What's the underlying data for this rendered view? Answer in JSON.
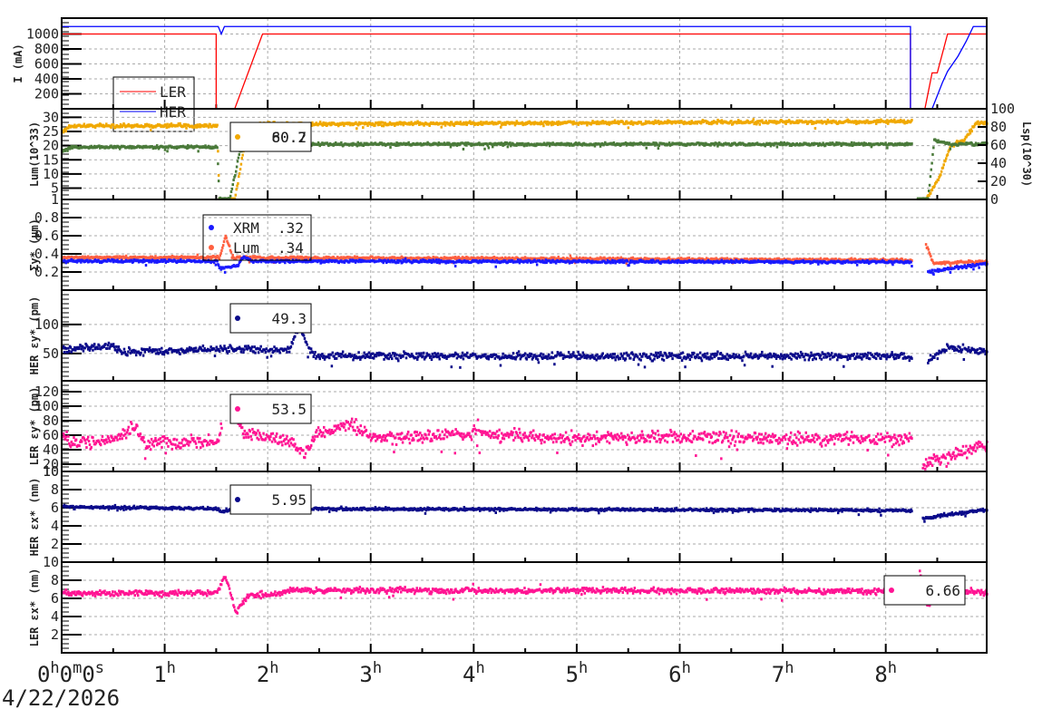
{
  "chart_data": {
    "type": "scatter",
    "x_unit": "hours",
    "xlim": [
      0,
      8.98
    ],
    "x_tick_labels": [
      "0h0m0s",
      "1h",
      "2h",
      "3h",
      "4h",
      "5h",
      "6h",
      "7h",
      "8h"
    ],
    "date_label": "4/22/2026",
    "grid": true,
    "panels": [
      {
        "ylabel": "I (mA)",
        "ylim": [
          0,
          1212
        ],
        "yticks": [
          200,
          400,
          600,
          800,
          1000
        ],
        "legend": {
          "placement": "left",
          "entries": [
            {
              "label": "LER",
              "color": "#ff0000"
            },
            {
              "label": "HER",
              "color": "#0000ff"
            }
          ]
        },
        "series": [
          {
            "name": "LER",
            "kind": "line",
            "color": "#ff0000",
            "segments": [
              [
                [
                  0,
                  1000
                ],
                [
                  1.5,
                  1000
                ],
                [
                  1.5,
                  0
                ],
                [
                  1.68,
                  0
                ],
                [
                  1.95,
                  1000
                ],
                [
                  8.24,
                  1000
                ],
                [
                  8.24,
                  0
                ],
                [
                  8.38,
                  0
                ],
                [
                  8.45,
                  480
                ],
                [
                  8.5,
                  480
                ],
                [
                  8.6,
                  1000
                ],
                [
                  8.98,
                  1000
                ]
              ]
            ]
          },
          {
            "name": "HER",
            "kind": "line",
            "color": "#0000ff",
            "segments": [
              [
                [
                  0,
                  1100
                ],
                [
                  1.52,
                  1100
                ],
                [
                  1.55,
                  1000
                ],
                [
                  1.58,
                  1100
                ],
                [
                  8.24,
                  1100
                ],
                [
                  8.24,
                  0
                ],
                [
                  8.45,
                  0
                ],
                [
                  8.55,
                  350
                ],
                [
                  8.6,
                  500
                ],
                [
                  8.7,
                  700
                ],
                [
                  8.78,
                  900
                ],
                [
                  8.85,
                  1100
                ],
                [
                  8.98,
                  1100
                ]
              ]
            ]
          }
        ]
      },
      {
        "ylabel": "Lum(10^33)",
        "ylim": [
          1,
          33
        ],
        "yticks": [
          1,
          5,
          10,
          15,
          20,
          25,
          30
        ],
        "right_axis": {
          "label": "Lsp(10^30)",
          "ylim": [
            0,
            100
          ],
          "yticks": [
            0,
            20,
            40,
            60,
            80,
            100
          ]
        },
        "legend": {
          "placement": "top-center",
          "values": [
            "80.7",
            "60.2"
          ],
          "color": "#f0a800"
        },
        "series": [
          {
            "name": "Lum",
            "color": "#f0a800",
            "noise": 0.5,
            "segments": [
              [
                [
                  0,
                  25
                ],
                [
                  0.1,
                  27
                ],
                [
                  1.5,
                  27
                ],
                [
                  1.52,
                  1
                ],
                [
                  1.67,
                  1
                ],
                [
                  1.8,
                  27.5
                ],
                [
                  8.25,
                  28.5
                ]
              ],
              [
                [
                  8.38,
                  1
                ],
                [
                  8.5,
                  8
                ],
                [
                  8.62,
                  20
                ],
                [
                  8.75,
                  22
                ],
                [
                  8.87,
                  28
                ],
                [
                  8.98,
                  28
                ]
              ]
            ]
          },
          {
            "name": "Lsp",
            "color": "#4a7a3a",
            "noise": 0.4,
            "segments": [
              [
                [
                  0,
                  18
                ],
                [
                  0.1,
                  19.5
                ],
                [
                  1.5,
                  19.5
                ],
                [
                  1.52,
                  1
                ],
                [
                  1.62,
                  1
                ],
                [
                  1.72,
                  18
                ],
                [
                  1.85,
                  20.5
                ],
                [
                  8.25,
                  20.5
                ]
              ],
              [
                [
                  8.3,
                  1
                ],
                [
                  8.4,
                  1
                ],
                [
                  8.46,
                  22
                ],
                [
                  8.6,
                  20.5
                ],
                [
                  8.98,
                  20.5
                ]
              ]
            ]
          }
        ]
      },
      {
        "ylabel": "Σy* (µm)",
        "ylim": [
          0,
          1.0
        ],
        "yticks": [
          0.2,
          0.4,
          0.6,
          0.8
        ],
        "legend": {
          "placement": "top-center",
          "entries": [
            {
              "label": "XRM",
              "value": ".32",
              "color": "#1a1aff"
            },
            {
              "label": "Lum",
              "value": ".34",
              "color": "#ff6040"
            }
          ]
        },
        "series": [
          {
            "name": "Lum",
            "color": "#ff6040",
            "noise": 0.012,
            "segments": [
              [
                [
                  0,
                  0.36
                ],
                [
                  1.5,
                  0.36
                ],
                [
                  1.52,
                  0.34
                ],
                [
                  1.58,
                  0.6
                ],
                [
                  1.65,
                  0.36
                ],
                [
                  8.25,
                  0.33
                ]
              ],
              [
                [
                  8.38,
                  0.5
                ],
                [
                  8.45,
                  0.3
                ],
                [
                  8.98,
                  0.31
                ]
              ]
            ]
          },
          {
            "name": "XRM",
            "color": "#1a1aff",
            "noise": 0.012,
            "segments": [
              [
                [
                  0,
                  0.32
                ],
                [
                  1.5,
                  0.32
                ],
                [
                  1.52,
                  0.24
                ],
                [
                  1.7,
                  0.27
                ],
                [
                  1.75,
                  0.36
                ],
                [
                  1.85,
                  0.32
                ],
                [
                  8.25,
                  0.31
                ]
              ],
              [
                [
                  8.4,
                  0.2
                ],
                [
                  8.98,
                  0.3
                ]
              ]
            ]
          }
        ]
      },
      {
        "ylabel": "HER εy* (pm)",
        "ylim": [
          3,
          159
        ],
        "yticks": [
          50,
          100
        ],
        "legend": {
          "placement": "top-center",
          "values": [
            "49.3"
          ],
          "color": "#0a0a8a"
        },
        "series": [
          {
            "name": "HER εy*",
            "color": "#0a0a8a",
            "noise": 5,
            "segments": [
              [
                [
                  0,
                  56
                ],
                [
                  0.5,
                  64
                ],
                [
                  0.55,
                  52
                ],
                [
                  1.2,
                  56
                ],
                [
                  1.5,
                  58
                ],
                [
                  2.2,
                  56
                ],
                [
                  2.3,
                  100
                ],
                [
                  2.38,
                  60
                ],
                [
                  2.45,
                  46
                ],
                [
                  8.25,
                  45
                ]
              ],
              [
                [
                  8.4,
                  36
                ],
                [
                  8.6,
                  62
                ],
                [
                  8.98,
                  52
                ]
              ]
            ]
          }
        ]
      },
      {
        "ylabel": "LER εy* (pm)",
        "ylim": [
          10,
          135
        ],
        "yticks": [
          10,
          20,
          40,
          60,
          80,
          100,
          120
        ],
        "legend": {
          "placement": "top-center",
          "values": [
            "53.5"
          ],
          "color": "#ff1493"
        },
        "series": [
          {
            "name": "LER εy*",
            "color": "#ff1493",
            "noise": 7,
            "segments": [
              [
                [
                  0,
                  60
                ],
                [
                  0.1,
                  48
                ],
                [
                  0.5,
                  55
                ],
                [
                  0.7,
                  72
                ],
                [
                  0.8,
                  50
                ],
                [
                  1.5,
                  52
                ],
                [
                  1.55,
                  75
                ]
              ],
              [
                [
                  1.65,
                  100
                ],
                [
                  1.75,
                  62
                ],
                [
                  2.2,
                  52
                ],
                [
                  2.35,
                  35
                ],
                [
                  2.45,
                  60
                ],
                [
                  2.8,
                  75
                ],
                [
                  3,
                  55
                ],
                [
                  4,
                  62
                ],
                [
                  5,
                  55
                ],
                [
                  6,
                  58
                ],
                [
                  7,
                  55
                ],
                [
                  8.25,
                  55
                ]
              ],
              [
                [
                  8.35,
                  20
                ],
                [
                  8.9,
                  45
                ],
                [
                  8.98,
                  45
                ]
              ]
            ]
          }
        ]
      },
      {
        "ylabel": "HER εx* (nm)",
        "ylim": [
          0,
          10
        ],
        "yticks": [
          2,
          4,
          6,
          8,
          10
        ],
        "legend": {
          "placement": "top-center",
          "values": [
            "5.95"
          ],
          "color": "#0a0a8a"
        },
        "series": [
          {
            "name": "HER εx*",
            "color": "#0a0a8a",
            "noise": 0.12,
            "segments": [
              [
                [
                  0,
                  6.1
                ],
                [
                  1.5,
                  5.9
                ],
                [
                  1.55,
                  5.5
                ],
                [
                  1.65,
                  5.9
                ],
                [
                  8.25,
                  5.7
                ]
              ],
              [
                [
                  8.35,
                  4.8
                ],
                [
                  8.9,
                  5.7
                ],
                [
                  8.98,
                  5.7
                ]
              ]
            ]
          }
        ]
      },
      {
        "ylabel": "LER εx* (nm)",
        "ylim": [
          0,
          10
        ],
        "yticks": [
          2,
          4,
          6,
          8,
          10
        ],
        "legend": {
          "placement": "right",
          "values": [
            "6.66"
          ],
          "color": "#ff1493"
        },
        "series": [
          {
            "name": "LER εx*",
            "color": "#ff1493",
            "noise": 0.25,
            "segments": [
              [
                [
                  0,
                  6.6
                ],
                [
                  1.5,
                  6.6
                ],
                [
                  1.58,
                  8.5
                ],
                [
                  1.68,
                  4.5
                ],
                [
                  1.8,
                  6.3
                ],
                [
                  2.1,
                  6.5
                ],
                [
                  2.2,
                  6.9
                ],
                [
                  8.25,
                  6.8
                ]
              ],
              [
                [
                  8.32,
                  9
                ],
                [
                  8.4,
                  5
                ],
                [
                  8.5,
                  6.8
                ],
                [
                  8.98,
                  6.7
                ]
              ]
            ]
          }
        ]
      }
    ]
  }
}
